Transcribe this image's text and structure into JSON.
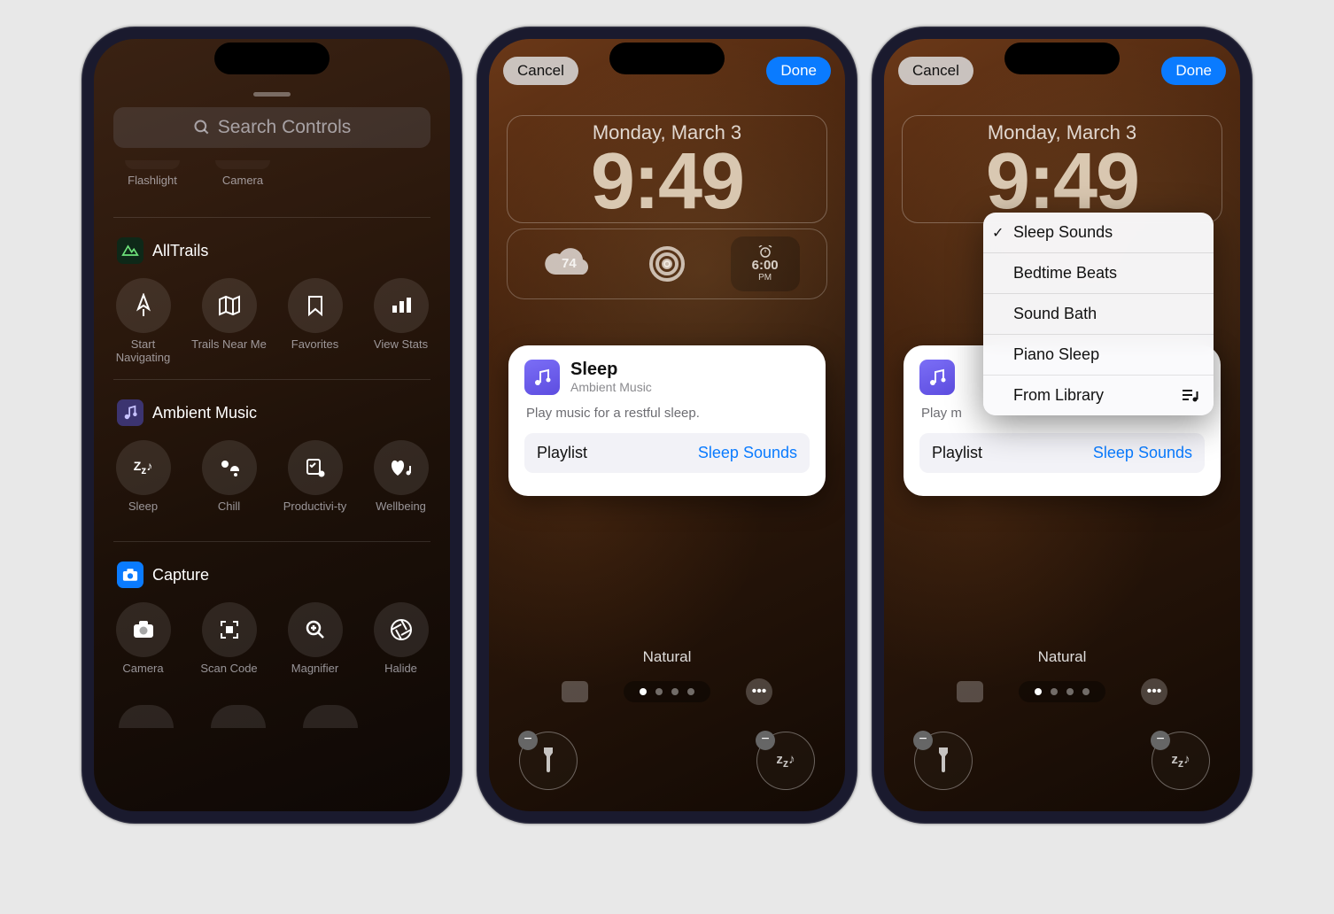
{
  "phone1": {
    "search_placeholder": "Search Controls",
    "partial_row": [
      {
        "label": "Flashlight"
      },
      {
        "label": "Camera"
      }
    ],
    "sections": [
      {
        "title": "AllTrails",
        "badge_bg": "#0e2818",
        "items": [
          {
            "label": "Start Navigating"
          },
          {
            "label": "Trails Near Me"
          },
          {
            "label": "Favorites"
          },
          {
            "label": "View Stats"
          }
        ]
      },
      {
        "title": "Ambient Music",
        "badge_bg": "#3c3470",
        "items": [
          {
            "label": "Sleep"
          },
          {
            "label": "Chill"
          },
          {
            "label": "Productivi-ty"
          },
          {
            "label": "Wellbeing"
          }
        ]
      },
      {
        "title": "Capture",
        "badge_bg": "#0a7bff",
        "items": [
          {
            "label": "Camera"
          },
          {
            "label": "Scan Code"
          },
          {
            "label": "Magnifier"
          },
          {
            "label": "Halide"
          }
        ]
      }
    ]
  },
  "lockscreen": {
    "cancel": "Cancel",
    "done": "Done",
    "date": "Monday, March 3",
    "time": "9:49",
    "widgets": {
      "temp": "74",
      "clock": "6:00",
      "clock_ampm": "PM"
    },
    "card": {
      "title": "Sleep",
      "subtitle": "Ambient Music",
      "description": "Play music for a restful sleep.",
      "picker_label": "Playlist",
      "picker_value": "Sleep Sounds"
    },
    "dropdown": [
      {
        "label": "Sleep Sounds",
        "checked": true
      },
      {
        "label": "Bedtime Beats"
      },
      {
        "label": "Sound Bath"
      },
      {
        "label": "Piano Sleep"
      },
      {
        "label": "From Library",
        "trailing": "playlist-icon"
      }
    ],
    "style_name": "Natural",
    "desc_truncated": "Play m"
  }
}
